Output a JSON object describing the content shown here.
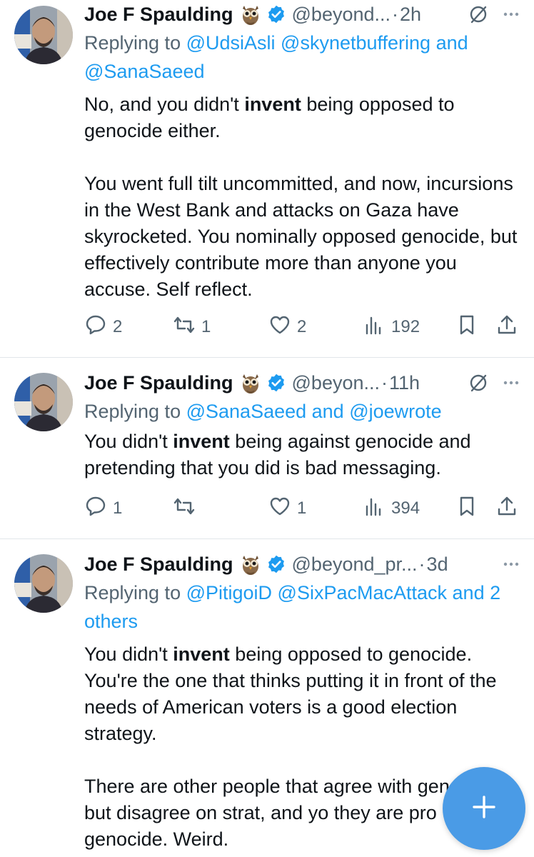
{
  "tweets": [
    {
      "name": "Joe F Spaulding",
      "handle": "@beyond...",
      "dot": "·",
      "time": "2h",
      "reply_prefix": "Replying to",
      "reply_mentions": "@UdsiAsli @skynetbuffering and @SanaSaeed",
      "paragraphs": [
        {
          "pre": "No, and you didn't ",
          "bold": "invent",
          "post": " being opposed to genocide either."
        },
        {
          "pre": "You went full tilt uncommitted, and now, incursions in the West Bank and attacks on Gaza have skyrocketed. You nominally opposed genocide, but effectively contribute more than anyone you accuse. Self reflect.",
          "bold": "",
          "post": ""
        }
      ],
      "replies": "2",
      "retweets": "1",
      "likes": "2",
      "views": "192"
    },
    {
      "name": "Joe F Spaulding",
      "handle": "@beyon...",
      "dot": "·",
      "time": "11h",
      "reply_prefix": "Replying to",
      "reply_mentions": "@SanaSaeed and @joewrote",
      "paragraphs": [
        {
          "pre": "You didn't ",
          "bold": "invent",
          "post": " being against genocide and pretending that you did is bad messaging."
        }
      ],
      "replies": "1",
      "retweets": "",
      "likes": "1",
      "views": "394"
    },
    {
      "name": "Joe F Spaulding",
      "handle": "@beyond_pr...",
      "dot": "·",
      "time": "3d",
      "reply_prefix": "Replying to",
      "reply_mentions": "@PitigoiD @SixPacMacAttack and 2 others",
      "paragraphs": [
        {
          "pre": "You didn't ",
          "bold": "invent",
          "post": " being opposed to genocide. You're the one that thinks putting it in front of the needs of American voters is a good election strategy."
        },
        {
          "pre": "There are other people that agree with genocide but disagree on strat, and yo they are pro genocide. Weird.",
          "bold": "",
          "post": ""
        }
      ],
      "replies": "",
      "retweets": "",
      "likes": "",
      "views": ""
    }
  ],
  "icons": {
    "reply": "reply-icon",
    "retweet": "retweet-icon",
    "like": "heart-icon",
    "views": "views-icon",
    "bookmark": "bookmark-icon",
    "share": "share-icon",
    "fab": "plus-icon",
    "owl": "owl-emoji-icon",
    "verified": "verified-badge-icon",
    "grok": "grok-icon",
    "more": "more-icon"
  },
  "colors": {
    "link": "#1d9bf0",
    "secondary": "#536471",
    "fab": "#4a9be6",
    "divider": "#e1e6ea"
  }
}
